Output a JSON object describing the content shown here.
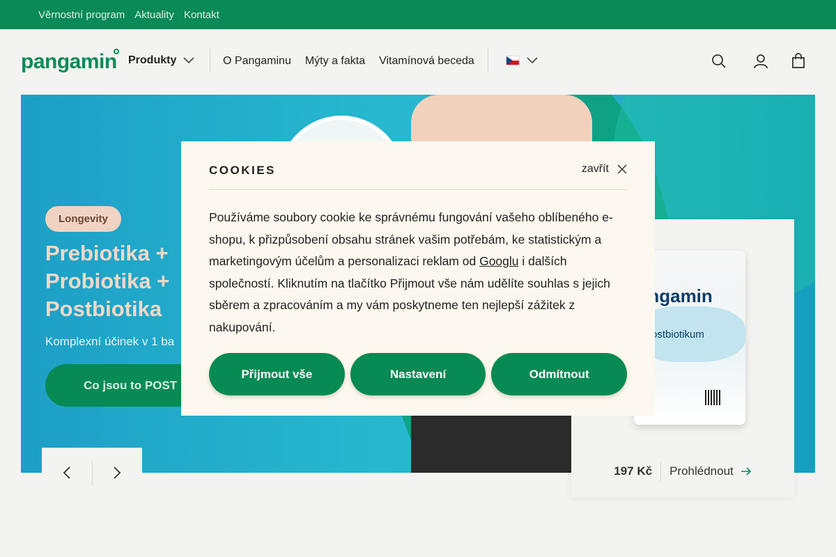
{
  "topbar": {
    "links": [
      "Věrnostní program",
      "Aktuality",
      "Kontakt"
    ]
  },
  "header": {
    "logo": "pangamin",
    "products_label": "Produkty",
    "nav": [
      "O Pangaminu",
      "Mýty a fakta",
      "Vitamínová beceda"
    ],
    "language_icon": "czech-flag-icon"
  },
  "hero": {
    "badge": "Longevity",
    "title": "Prebiotika + Probiotika + Postbiotika",
    "subtitle": "Komplexní účinek v 1 ba",
    "cta": "Co jsou to POST"
  },
  "product_card": {
    "brand": "pangamin",
    "name": "fi postbiotikum",
    "price": "197 Kč",
    "view_label": "Prohlédnout"
  },
  "cookies": {
    "title": "COOKIES",
    "close_label": "zavřít",
    "text_before_link": "Používáme soubory cookie ke správnému fungování vašeho oblíbeného e-shopu, k přizpůsobení obsahu stránek vašim potřebám, ke statistickým a marketingovým účelům a personalizaci reklam od ",
    "link": "Googlu",
    "text_after_link": " i dalších společností. Kliknutím na tlačítko Přijmout vše nám udělíte souhlas s jejich sběrem a zpracováním a my vám poskytneme ten nejlepší zážitek z nakupování.",
    "accept_all": "Přijmout vše",
    "settings": "Nastavení",
    "reject": "Odmítnout"
  },
  "colors": {
    "brand_green": "#078a53",
    "topbar_green": "#0a8a57",
    "modal_bg": "#fdf8ef",
    "hero_blue": "#27b8cf"
  }
}
